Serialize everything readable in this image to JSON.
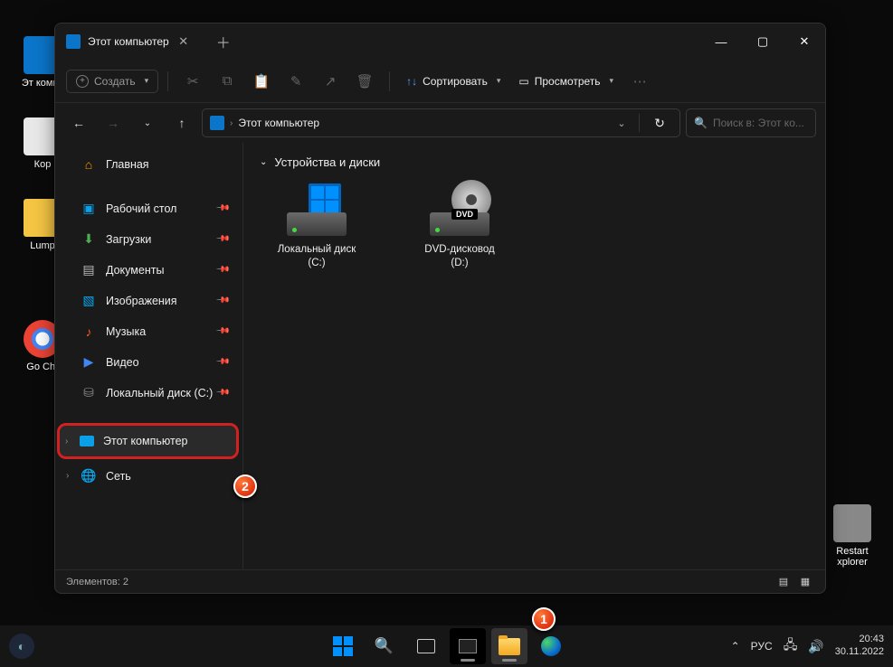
{
  "desktop_icons": {
    "this_pc": "Эт\nкомпь",
    "recycle": "Кор",
    "lump": "Lump",
    "chrome": "Go\nChr",
    "restart": "Restart\nxplorer"
  },
  "window": {
    "tab_title": "Этот компьютер",
    "toolbar": {
      "create": "Создать",
      "sort": "Сортировать",
      "view": "Просмотреть"
    },
    "breadcrumb": "Этот компьютер",
    "search_placeholder": "Поиск в: Этот ко...",
    "sidebar": {
      "home": "Главная",
      "desktop": "Рабочий стол",
      "downloads": "Загрузки",
      "documents": "Документы",
      "pictures": "Изображения",
      "music": "Музыка",
      "videos": "Видео",
      "localdisk": "Локальный диск (C:)",
      "this_pc": "Этот компьютер",
      "network": "Сеть"
    },
    "content": {
      "group_title": "Устройства и диски",
      "drive_c": "Локальный диск (C:)",
      "drive_d": "DVD-дисковод (D:)",
      "dvd_badge": "DVD"
    },
    "status": "Элементов: 2"
  },
  "callouts": {
    "one": "1",
    "two": "2"
  },
  "taskbar": {
    "lang": "РУС",
    "time": "20:43",
    "date": "30.11.2022"
  }
}
